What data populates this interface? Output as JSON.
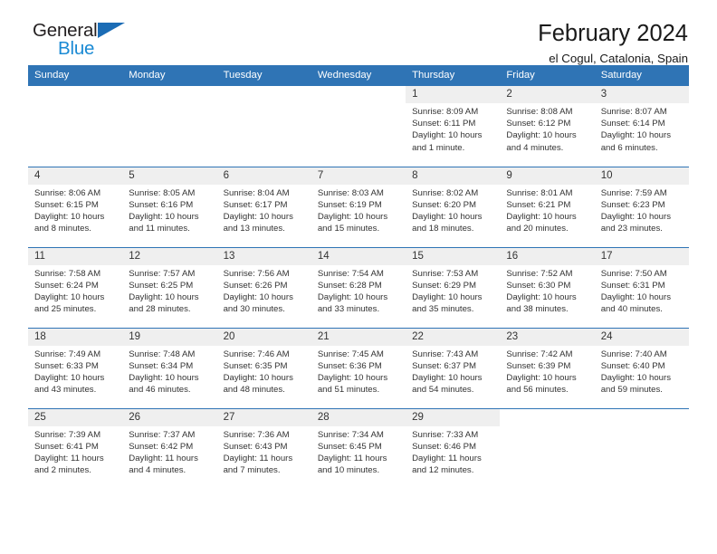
{
  "brand": {
    "name_part1": "General",
    "name_part2": "Blue",
    "triangle_color": "#1b6cb5",
    "blue_color": "#1a8ad4"
  },
  "header": {
    "title": "February 2024",
    "location": "el Cogul, Catalonia, Spain"
  },
  "theme": {
    "header_blue": "#2f74b5",
    "daynum_band": "#efefef",
    "text": "#333333"
  },
  "weekday_headers": [
    "Sunday",
    "Monday",
    "Tuesday",
    "Wednesday",
    "Thursday",
    "Friday",
    "Saturday"
  ],
  "weeks": [
    [
      {
        "day": "",
        "sunrise": "",
        "sunset": "",
        "daylight_line1": "",
        "daylight_line2": ""
      },
      {
        "day": "",
        "sunrise": "",
        "sunset": "",
        "daylight_line1": "",
        "daylight_line2": ""
      },
      {
        "day": "",
        "sunrise": "",
        "sunset": "",
        "daylight_line1": "",
        "daylight_line2": ""
      },
      {
        "day": "",
        "sunrise": "",
        "sunset": "",
        "daylight_line1": "",
        "daylight_line2": ""
      },
      {
        "day": "1",
        "sunrise": "Sunrise: 8:09 AM",
        "sunset": "Sunset: 6:11 PM",
        "daylight_line1": "Daylight: 10 hours",
        "daylight_line2": "and 1 minute."
      },
      {
        "day": "2",
        "sunrise": "Sunrise: 8:08 AM",
        "sunset": "Sunset: 6:12 PM",
        "daylight_line1": "Daylight: 10 hours",
        "daylight_line2": "and 4 minutes."
      },
      {
        "day": "3",
        "sunrise": "Sunrise: 8:07 AM",
        "sunset": "Sunset: 6:14 PM",
        "daylight_line1": "Daylight: 10 hours",
        "daylight_line2": "and 6 minutes."
      }
    ],
    [
      {
        "day": "4",
        "sunrise": "Sunrise: 8:06 AM",
        "sunset": "Sunset: 6:15 PM",
        "daylight_line1": "Daylight: 10 hours",
        "daylight_line2": "and 8 minutes."
      },
      {
        "day": "5",
        "sunrise": "Sunrise: 8:05 AM",
        "sunset": "Sunset: 6:16 PM",
        "daylight_line1": "Daylight: 10 hours",
        "daylight_line2": "and 11 minutes."
      },
      {
        "day": "6",
        "sunrise": "Sunrise: 8:04 AM",
        "sunset": "Sunset: 6:17 PM",
        "daylight_line1": "Daylight: 10 hours",
        "daylight_line2": "and 13 minutes."
      },
      {
        "day": "7",
        "sunrise": "Sunrise: 8:03 AM",
        "sunset": "Sunset: 6:19 PM",
        "daylight_line1": "Daylight: 10 hours",
        "daylight_line2": "and 15 minutes."
      },
      {
        "day": "8",
        "sunrise": "Sunrise: 8:02 AM",
        "sunset": "Sunset: 6:20 PM",
        "daylight_line1": "Daylight: 10 hours",
        "daylight_line2": "and 18 minutes."
      },
      {
        "day": "9",
        "sunrise": "Sunrise: 8:01 AM",
        "sunset": "Sunset: 6:21 PM",
        "daylight_line1": "Daylight: 10 hours",
        "daylight_line2": "and 20 minutes."
      },
      {
        "day": "10",
        "sunrise": "Sunrise: 7:59 AM",
        "sunset": "Sunset: 6:23 PM",
        "daylight_line1": "Daylight: 10 hours",
        "daylight_line2": "and 23 minutes."
      }
    ],
    [
      {
        "day": "11",
        "sunrise": "Sunrise: 7:58 AM",
        "sunset": "Sunset: 6:24 PM",
        "daylight_line1": "Daylight: 10 hours",
        "daylight_line2": "and 25 minutes."
      },
      {
        "day": "12",
        "sunrise": "Sunrise: 7:57 AM",
        "sunset": "Sunset: 6:25 PM",
        "daylight_line1": "Daylight: 10 hours",
        "daylight_line2": "and 28 minutes."
      },
      {
        "day": "13",
        "sunrise": "Sunrise: 7:56 AM",
        "sunset": "Sunset: 6:26 PM",
        "daylight_line1": "Daylight: 10 hours",
        "daylight_line2": "and 30 minutes."
      },
      {
        "day": "14",
        "sunrise": "Sunrise: 7:54 AM",
        "sunset": "Sunset: 6:28 PM",
        "daylight_line1": "Daylight: 10 hours",
        "daylight_line2": "and 33 minutes."
      },
      {
        "day": "15",
        "sunrise": "Sunrise: 7:53 AM",
        "sunset": "Sunset: 6:29 PM",
        "daylight_line1": "Daylight: 10 hours",
        "daylight_line2": "and 35 minutes."
      },
      {
        "day": "16",
        "sunrise": "Sunrise: 7:52 AM",
        "sunset": "Sunset: 6:30 PM",
        "daylight_line1": "Daylight: 10 hours",
        "daylight_line2": "and 38 minutes."
      },
      {
        "day": "17",
        "sunrise": "Sunrise: 7:50 AM",
        "sunset": "Sunset: 6:31 PM",
        "daylight_line1": "Daylight: 10 hours",
        "daylight_line2": "and 40 minutes."
      }
    ],
    [
      {
        "day": "18",
        "sunrise": "Sunrise: 7:49 AM",
        "sunset": "Sunset: 6:33 PM",
        "daylight_line1": "Daylight: 10 hours",
        "daylight_line2": "and 43 minutes."
      },
      {
        "day": "19",
        "sunrise": "Sunrise: 7:48 AM",
        "sunset": "Sunset: 6:34 PM",
        "daylight_line1": "Daylight: 10 hours",
        "daylight_line2": "and 46 minutes."
      },
      {
        "day": "20",
        "sunrise": "Sunrise: 7:46 AM",
        "sunset": "Sunset: 6:35 PM",
        "daylight_line1": "Daylight: 10 hours",
        "daylight_line2": "and 48 minutes."
      },
      {
        "day": "21",
        "sunrise": "Sunrise: 7:45 AM",
        "sunset": "Sunset: 6:36 PM",
        "daylight_line1": "Daylight: 10 hours",
        "daylight_line2": "and 51 minutes."
      },
      {
        "day": "22",
        "sunrise": "Sunrise: 7:43 AM",
        "sunset": "Sunset: 6:37 PM",
        "daylight_line1": "Daylight: 10 hours",
        "daylight_line2": "and 54 minutes."
      },
      {
        "day": "23",
        "sunrise": "Sunrise: 7:42 AM",
        "sunset": "Sunset: 6:39 PM",
        "daylight_line1": "Daylight: 10 hours",
        "daylight_line2": "and 56 minutes."
      },
      {
        "day": "24",
        "sunrise": "Sunrise: 7:40 AM",
        "sunset": "Sunset: 6:40 PM",
        "daylight_line1": "Daylight: 10 hours",
        "daylight_line2": "and 59 minutes."
      }
    ],
    [
      {
        "day": "25",
        "sunrise": "Sunrise: 7:39 AM",
        "sunset": "Sunset: 6:41 PM",
        "daylight_line1": "Daylight: 11 hours",
        "daylight_line2": "and 2 minutes."
      },
      {
        "day": "26",
        "sunrise": "Sunrise: 7:37 AM",
        "sunset": "Sunset: 6:42 PM",
        "daylight_line1": "Daylight: 11 hours",
        "daylight_line2": "and 4 minutes."
      },
      {
        "day": "27",
        "sunrise": "Sunrise: 7:36 AM",
        "sunset": "Sunset: 6:43 PM",
        "daylight_line1": "Daylight: 11 hours",
        "daylight_line2": "and 7 minutes."
      },
      {
        "day": "28",
        "sunrise": "Sunrise: 7:34 AM",
        "sunset": "Sunset: 6:45 PM",
        "daylight_line1": "Daylight: 11 hours",
        "daylight_line2": "and 10 minutes."
      },
      {
        "day": "29",
        "sunrise": "Sunrise: 7:33 AM",
        "sunset": "Sunset: 6:46 PM",
        "daylight_line1": "Daylight: 11 hours",
        "daylight_line2": "and 12 minutes."
      },
      {
        "day": "",
        "sunrise": "",
        "sunset": "",
        "daylight_line1": "",
        "daylight_line2": ""
      },
      {
        "day": "",
        "sunrise": "",
        "sunset": "",
        "daylight_line1": "",
        "daylight_line2": ""
      }
    ]
  ]
}
